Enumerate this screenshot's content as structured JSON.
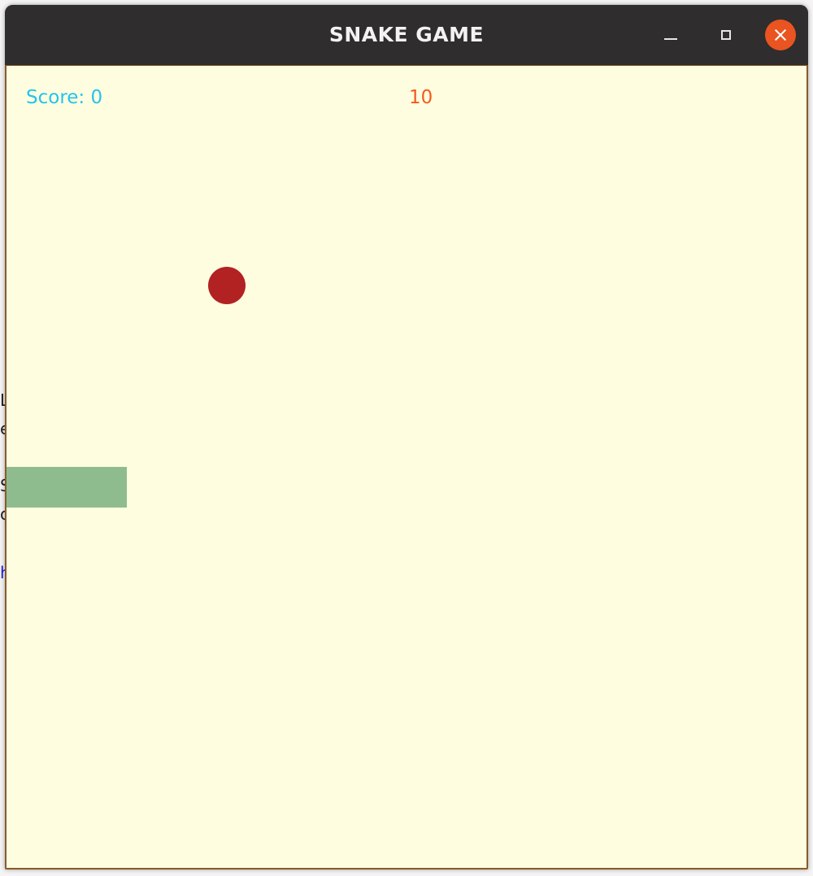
{
  "window": {
    "title": "SNAKE GAME",
    "controls": {
      "minimize": "minimize",
      "maximize": "maximize",
      "close": "close"
    },
    "close_color": "#e95420"
  },
  "hud": {
    "score_text": "Score: 0",
    "countdown": "10",
    "score_color": "#22c4ee",
    "countdown_color": "#f35a1e"
  },
  "board": {
    "background": "#fffddf",
    "food_color": "#b22222",
    "snake_color": "#8fbc8f",
    "snake_length": 3
  },
  "background_peek": [
    "L",
    "e",
    "S",
    "c",
    "h"
  ]
}
